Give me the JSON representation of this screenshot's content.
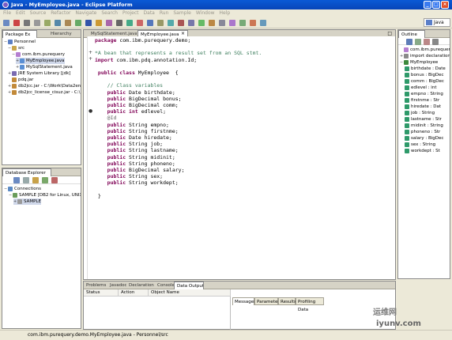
{
  "window": {
    "title": "Java - MyEmployee.java - Eclipse Platform"
  },
  "menu": [
    "File",
    "Edit",
    "Source",
    "Refactor",
    "Navigate",
    "Search",
    "Project",
    "Data",
    "Run",
    "Sample",
    "Window",
    "Help"
  ],
  "perspective": {
    "label": "Java"
  },
  "package_explorer": {
    "tabs": [
      "Package Ex",
      "Hierarchy"
    ],
    "items": [
      {
        "label": "Personnel",
        "depth": 0,
        "icon": "project-icon",
        "twisty": "−"
      },
      {
        "label": "src",
        "depth": 1,
        "icon": "src-folder-icon",
        "twisty": "−"
      },
      {
        "label": "com.ibm.purequery",
        "depth": 2,
        "icon": "package-icon",
        "twisty": "−"
      },
      {
        "label": "MyEmployee.java",
        "depth": 3,
        "icon": "java-file-icon",
        "twisty": "+",
        "selected": true
      },
      {
        "label": "MySqlStatement.java",
        "depth": 3,
        "icon": "java-file-icon",
        "twisty": "+"
      },
      {
        "label": "JRE System Library [jdk]",
        "depth": 1,
        "icon": "library-icon",
        "twisty": "+"
      },
      {
        "label": "pdq.jar",
        "depth": 1,
        "icon": "jar-icon",
        "twisty": ""
      },
      {
        "label": "db2jcc.jar - C:\\Work\\Data2en",
        "depth": 1,
        "icon": "jar-icon",
        "twisty": "+"
      },
      {
        "label": "db2jcc_license_cisuz.jar - C:\\",
        "depth": 1,
        "icon": "jar-icon",
        "twisty": "+"
      }
    ]
  },
  "database_explorer": {
    "tab": "Database Explorer",
    "items": [
      {
        "label": "Connections",
        "depth": 0,
        "icon": "connections-icon",
        "twisty": "−"
      },
      {
        "label": "SAMPLE [DB2 for Linux, UNIX",
        "depth": 1,
        "icon": "database-icon",
        "twisty": "−"
      },
      {
        "label": "SAMPLE",
        "depth": 2,
        "icon": "schema-icon",
        "twisty": "+",
        "selected": true
      }
    ]
  },
  "editor": {
    "tabs": [
      "MySqlStatement.java",
      "MyEmployee.java"
    ],
    "lines": [
      [
        {
          "t": "package",
          "c": "kw"
        },
        {
          "t": " com.ibm.purequery.demo;",
          "c": ""
        }
      ],
      [],
      [
        {
          "t": "*A bean that represents a result set from an SQL stmt.",
          "c": "cm"
        }
      ],
      [
        {
          "t": "import",
          "c": "kw"
        },
        {
          "t": " com.ibm.pdq.annotation.Id;",
          "c": ""
        }
      ],
      [],
      [
        {
          "t": " public class",
          "c": "kw"
        },
        {
          "t": " MyEmployee  {",
          "c": ""
        }
      ],
      [],
      [
        {
          "t": "    // Class variables",
          "c": "cm"
        }
      ],
      [
        {
          "t": "    public",
          "c": "kw"
        },
        {
          "t": " Date birthdate;",
          "c": ""
        }
      ],
      [
        {
          "t": "    public",
          "c": "kw"
        },
        {
          "t": " BigDecimal bonus;",
          "c": ""
        }
      ],
      [
        {
          "t": "    public",
          "c": "kw"
        },
        {
          "t": " BigDecimal comm;",
          "c": ""
        }
      ],
      [
        {
          "t": "    public int",
          "c": "kw"
        },
        {
          "t": " edlevel;",
          "c": ""
        }
      ],
      [
        {
          "t": "    @Id",
          "c": "ann"
        }
      ],
      [
        {
          "t": "    public",
          "c": "kw"
        },
        {
          "t": " String empno;",
          "c": ""
        }
      ],
      [
        {
          "t": "    public",
          "c": "kw"
        },
        {
          "t": " String firstnme;",
          "c": ""
        }
      ],
      [
        {
          "t": "    public",
          "c": "kw"
        },
        {
          "t": " Date hiredate;",
          "c": ""
        }
      ],
      [
        {
          "t": "    public",
          "c": "kw"
        },
        {
          "t": " String job;",
          "c": ""
        }
      ],
      [
        {
          "t": "    public",
          "c": "kw"
        },
        {
          "t": " String lastname;",
          "c": ""
        }
      ],
      [
        {
          "t": "    public",
          "c": "kw"
        },
        {
          "t": " String midinit;",
          "c": ""
        }
      ],
      [
        {
          "t": "    public",
          "c": "kw"
        },
        {
          "t": " String phoneno;",
          "c": ""
        }
      ],
      [
        {
          "t": "    public",
          "c": "kw"
        },
        {
          "t": " BigDecimal salary;",
          "c": ""
        }
      ],
      [
        {
          "t": "    public",
          "c": "kw"
        },
        {
          "t": " String sex;",
          "c": ""
        }
      ],
      [
        {
          "t": "    public",
          "c": "kw"
        },
        {
          "t": " String workdept;",
          "c": ""
        }
      ],
      [],
      [
        {
          "t": " }",
          "c": ""
        }
      ]
    ]
  },
  "outline": {
    "tab": "Outline",
    "items": [
      {
        "label": "com.ibm.purequery",
        "depth": 0,
        "icon": "package-icon",
        "twisty": ""
      },
      {
        "label": "import declaration",
        "depth": 0,
        "icon": "imports-icon",
        "twisty": "+"
      },
      {
        "label": "MyEmployee",
        "depth": 0,
        "icon": "class-icon",
        "twisty": "−"
      },
      {
        "label": "birthdate : Date",
        "depth": 1,
        "icon": "field-icon"
      },
      {
        "label": "bonus : BigDec",
        "depth": 1,
        "icon": "field-icon"
      },
      {
        "label": "comm : BigDec",
        "depth": 1,
        "icon": "field-icon"
      },
      {
        "label": "edlevel : int",
        "depth": 1,
        "icon": "field-icon"
      },
      {
        "label": "empno : String",
        "depth": 1,
        "icon": "field-icon"
      },
      {
        "label": "firstnme : Str",
        "depth": 1,
        "icon": "field-icon"
      },
      {
        "label": "hiredate : Dat",
        "depth": 1,
        "icon": "field-icon"
      },
      {
        "label": "job : String",
        "depth": 1,
        "icon": "field-icon"
      },
      {
        "label": "lastname : Str",
        "depth": 1,
        "icon": "field-icon"
      },
      {
        "label": "midinit : String",
        "depth": 1,
        "icon": "field-icon"
      },
      {
        "label": "phoneno : Str",
        "depth": 1,
        "icon": "field-icon"
      },
      {
        "label": "salary : BigDec",
        "depth": 1,
        "icon": "field-icon"
      },
      {
        "label": "sex : String",
        "depth": 1,
        "icon": "field-icon"
      },
      {
        "label": "workdept : St",
        "depth": 1,
        "icon": "field-icon"
      }
    ]
  },
  "bottom_panel": {
    "tabs": [
      "Problems",
      "Javadoc",
      "Declaration",
      "Console",
      "Data Output"
    ],
    "columns": [
      "Status",
      "Action",
      "Object Name"
    ],
    "result_tabs": [
      "Messages",
      "Parameters",
      "Results",
      "Profiling Data"
    ]
  },
  "status_bar": {
    "text": "com.ibm.purequery.demo.MyEmployee.java - Personnel/src"
  },
  "watermark": {
    "line1": "运维网",
    "line2": "iyunv.com"
  },
  "colors": {
    "keyword": "#7f0055",
    "comment": "#3f7f5f",
    "titlebar": "#0a5ad6"
  }
}
